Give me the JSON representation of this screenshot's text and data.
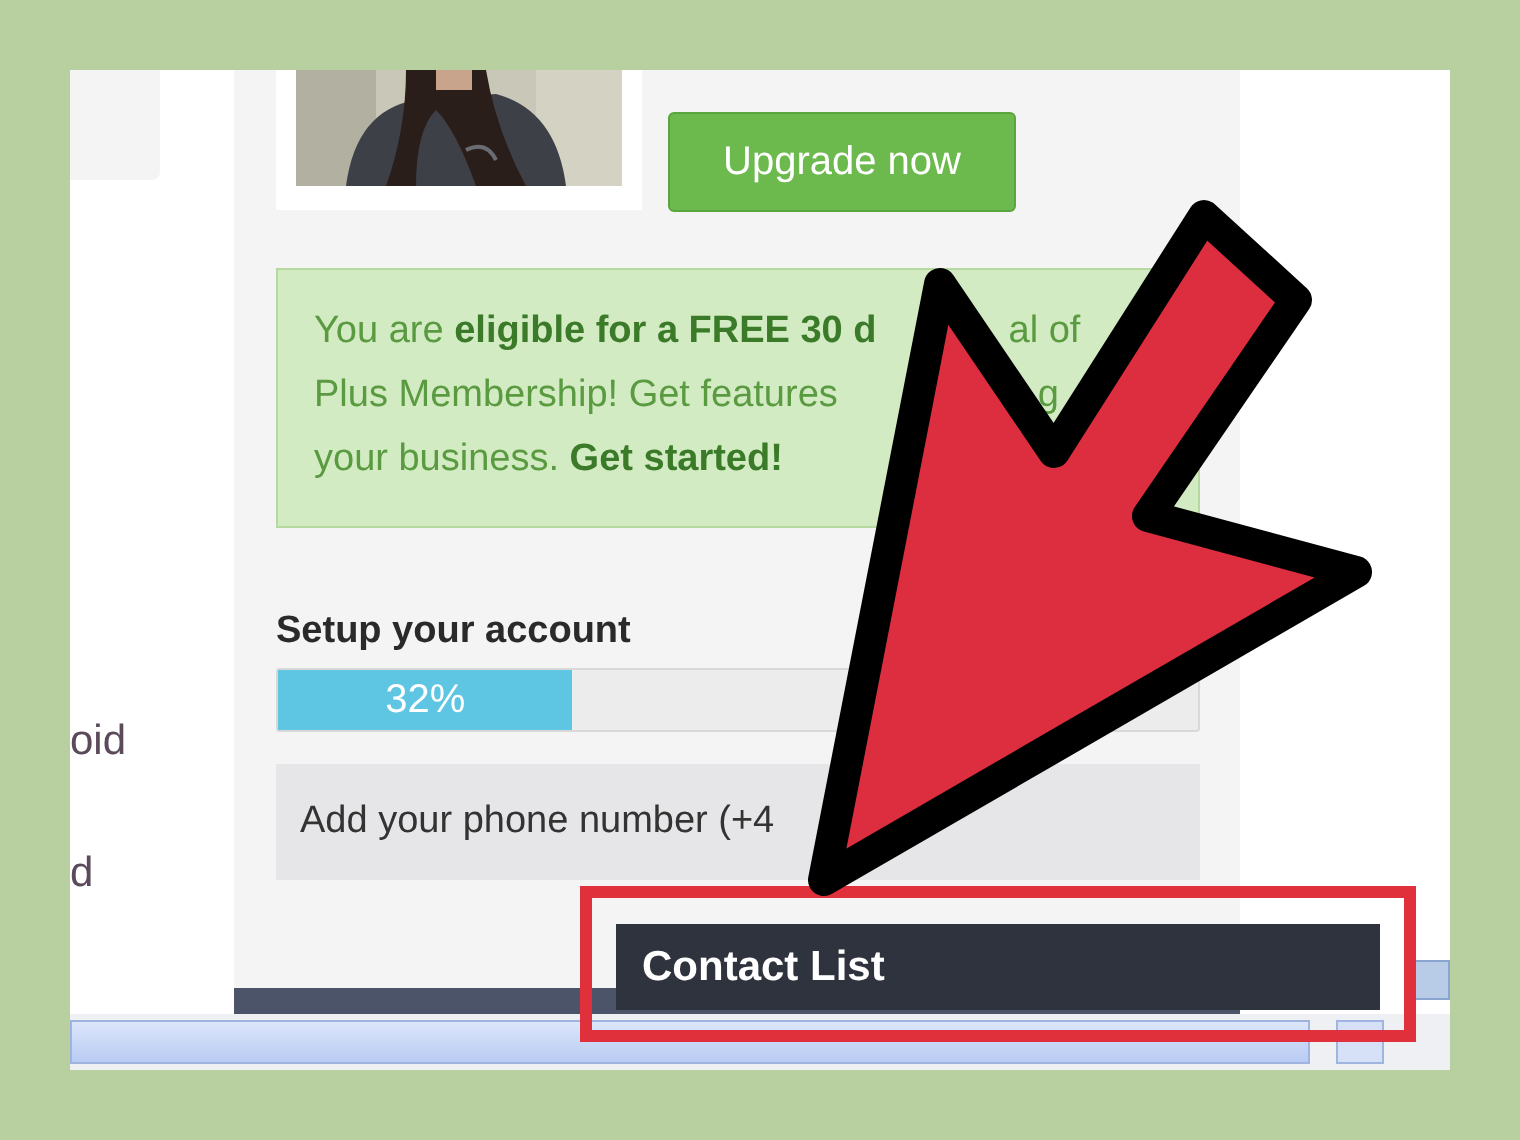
{
  "sidebar": {
    "items": [
      {
        "label": "oid"
      },
      {
        "label": "d"
      }
    ]
  },
  "profile": {
    "upgrade_button": "Upgrade now"
  },
  "promo": {
    "lines": [
      [
        "You are **eligible for a FREE 30 d**",
        "al of"
      ],
      [
        "Plus Membership! Get features",
        "g"
      ],
      [
        "your business. **Get started!**"
      ]
    ]
  },
  "setup": {
    "title": "Setup your account",
    "progress": {
      "level": 0.32,
      "reading": "32%"
    },
    "task": "Add your phone number (+4"
  },
  "chat_bar": {
    "title": "Contact List"
  }
}
